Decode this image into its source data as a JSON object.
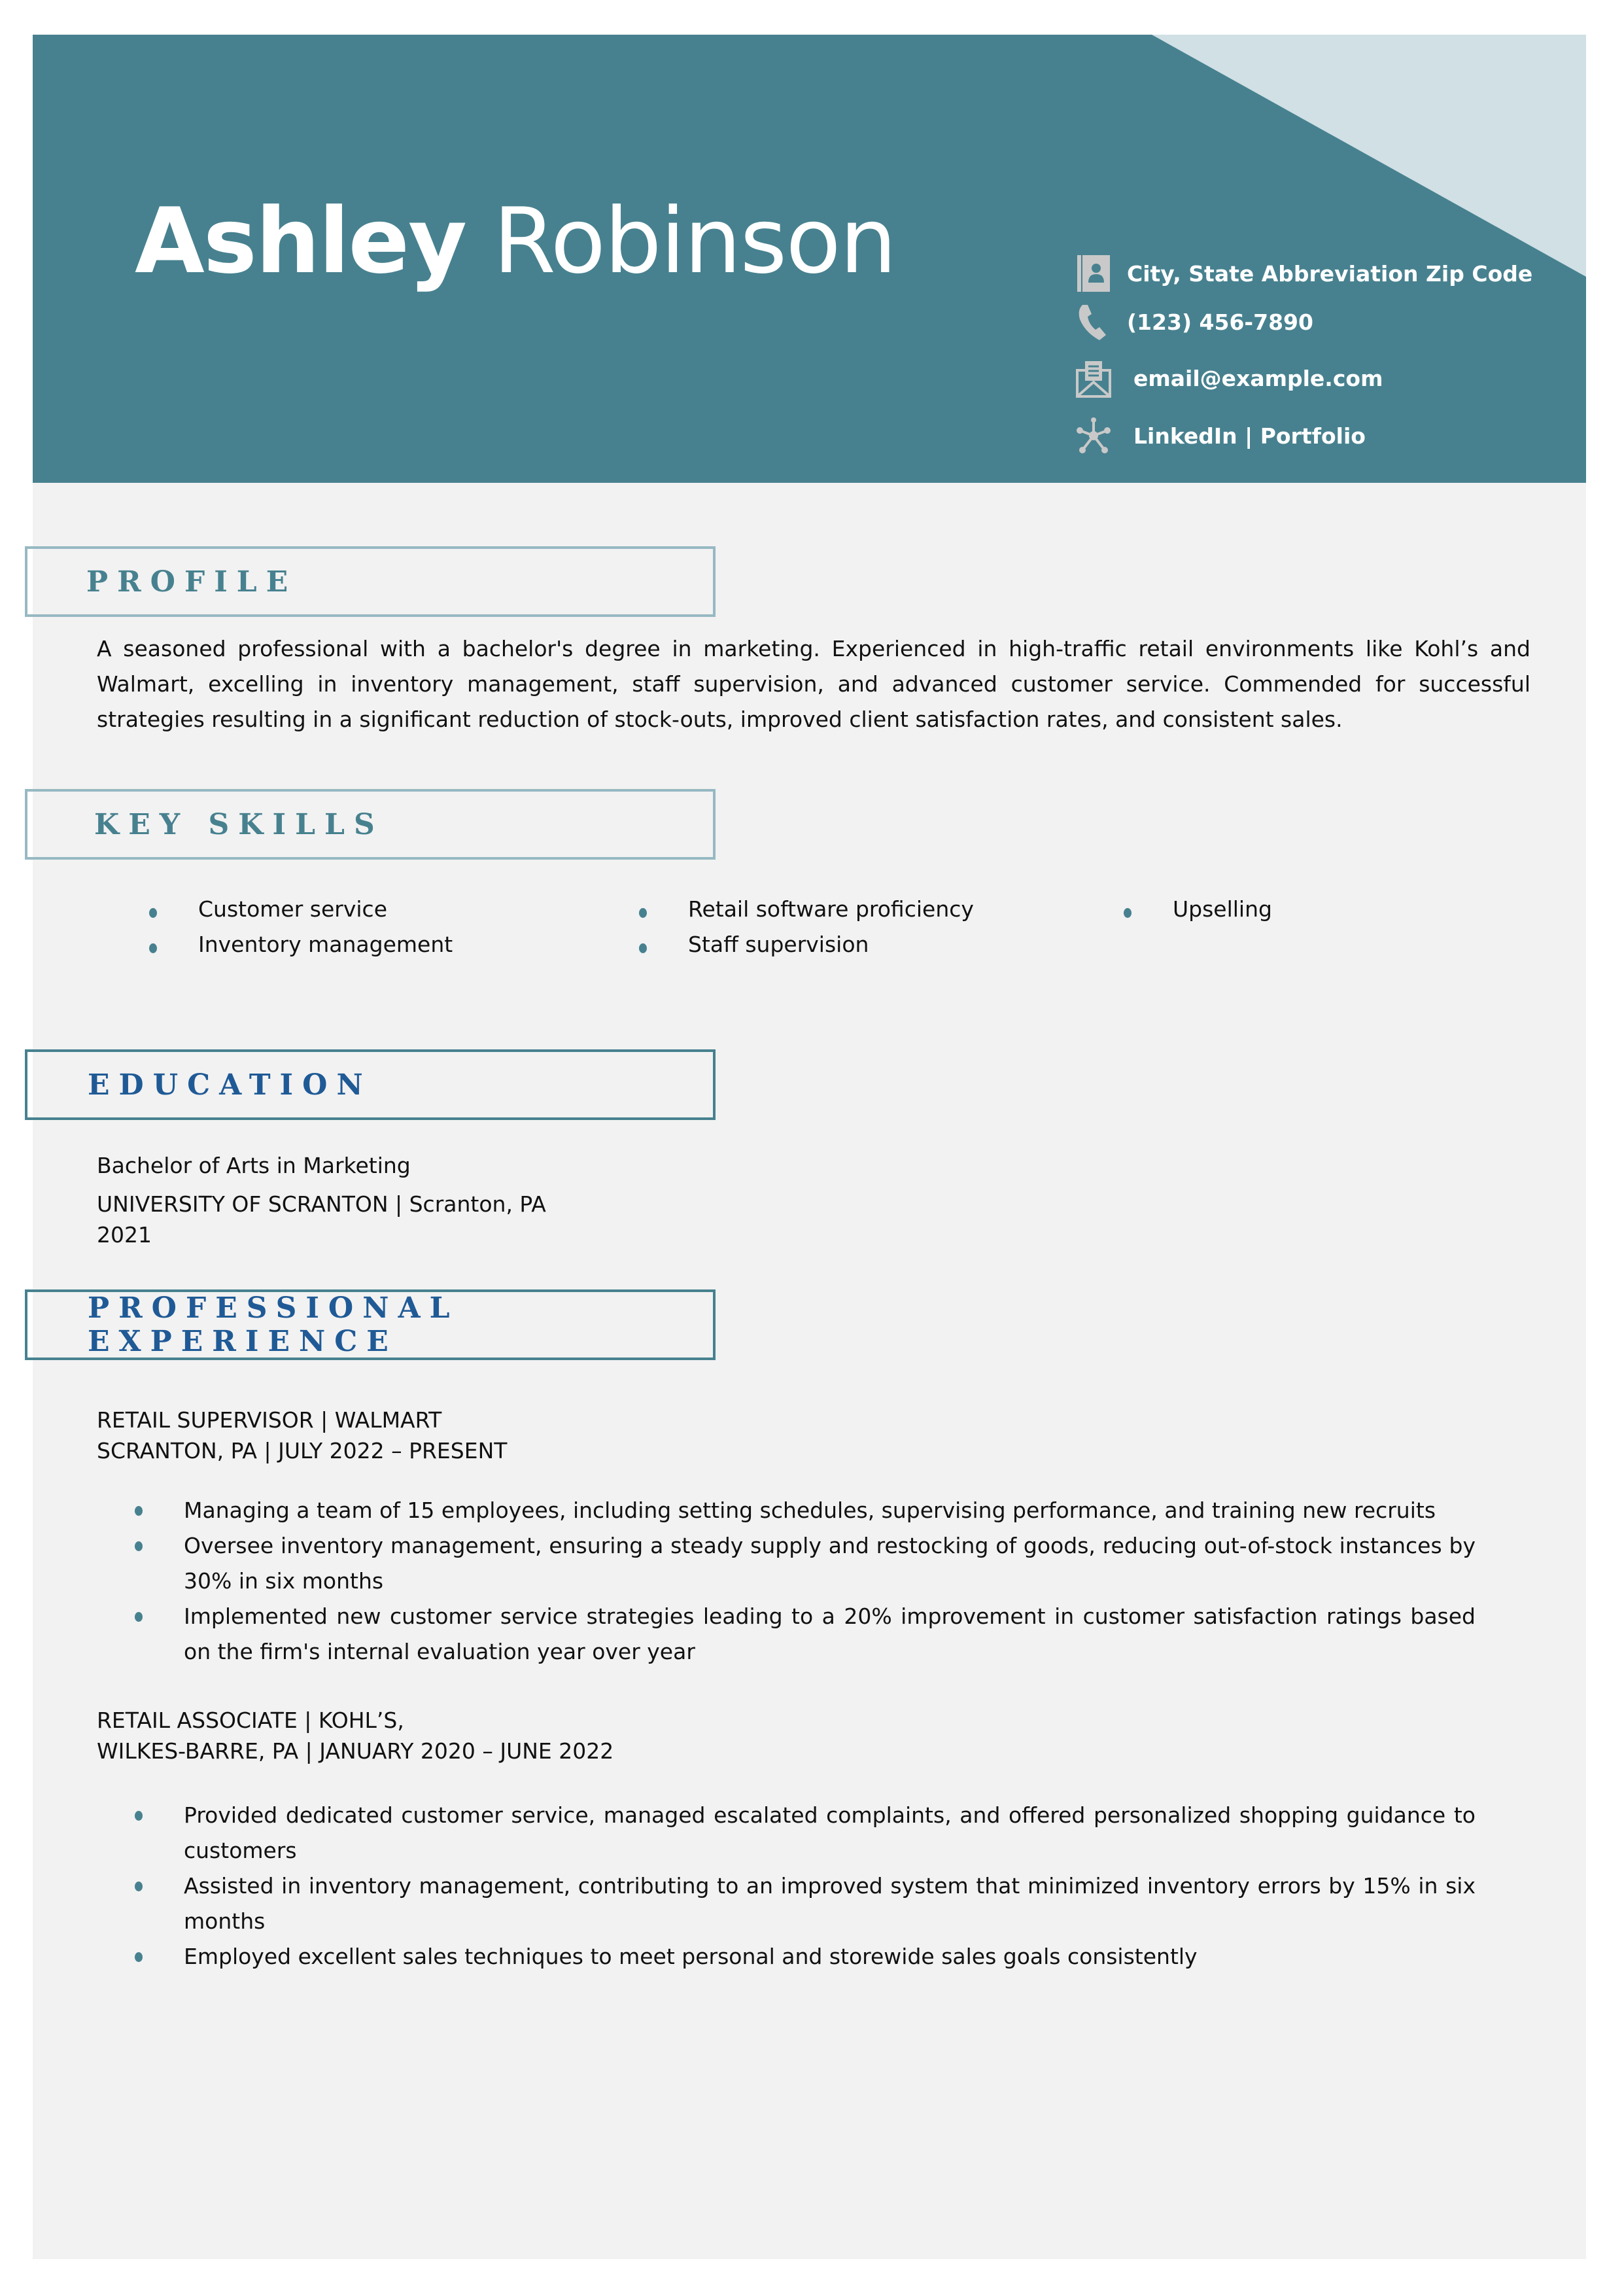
{
  "header": {
    "first_name": "Ashley",
    "last_name": "Robinson",
    "accent_color": "#47818f",
    "triangle_color": "#d0e0e5",
    "contact": [
      {
        "icon": "address-book-icon",
        "text": "City, State Abbreviation Zip Code"
      },
      {
        "icon": "phone-icon",
        "text": "(123) 456-7890"
      },
      {
        "icon": "email-icon",
        "text": "email@example.com"
      },
      {
        "icon": "network-icon",
        "text": "LinkedIn | Portfolio"
      }
    ]
  },
  "sections": {
    "profile": {
      "title": "PROFILE",
      "text": "A seasoned professional with a bachelor's degree in marketing. Experienced in high-traffic retail environments like Kohl’s and Walmart, excelling in inventory management, staff supervision, and advanced customer service. Commended for successful strategies resulting in a significant reduction of stock-outs, improved client satisfaction rates, and consistent sales."
    },
    "skills": {
      "title": "KEY SKILLS",
      "items": [
        "Customer service",
        "Inventory management",
        "Retail software proficiency",
        "Staff supervision",
        "Upselling"
      ]
    },
    "education": {
      "title": "EDUCATION",
      "degree": "Bachelor of Arts in Marketing",
      "school": "UNIVERSITY OF SCRANTON | Scranton, PA",
      "year": "2021"
    },
    "experience": {
      "title": "PROFESSIONAL EXPERIENCE",
      "jobs": [
        {
          "title_line": "RETAIL SUPERVISOR | WALMART",
          "meta_line": "SCRANTON, PA | JULY 2022 – PRESENT",
          "bullets": [
            "Managing a team of 15 employees, including setting schedules, supervising performance, and training new recruits",
            "Oversee inventory management, ensuring a steady supply and restocking of goods, reducing out-of-stock instances by 30% in six months",
            "Implemented new customer service strategies leading to a 20% improvement in customer satisfaction ratings based on the firm's internal evaluation year over year"
          ]
        },
        {
          "title_line": "RETAIL ASSOCIATE | KOHL’S,",
          "meta_line": "WILKES-BARRE, PA | JANUARY 2020 – JUNE 2022",
          "bullets": [
            "Provided dedicated customer service, managed escalated complaints, and offered personalized shopping guidance to customers",
            "Assisted in inventory management, contributing to an improved system that minimized inventory errors by 15% in six months",
            "Employed excellent sales techniques to meet personal and storewide sales goals consistently"
          ]
        }
      ]
    }
  }
}
